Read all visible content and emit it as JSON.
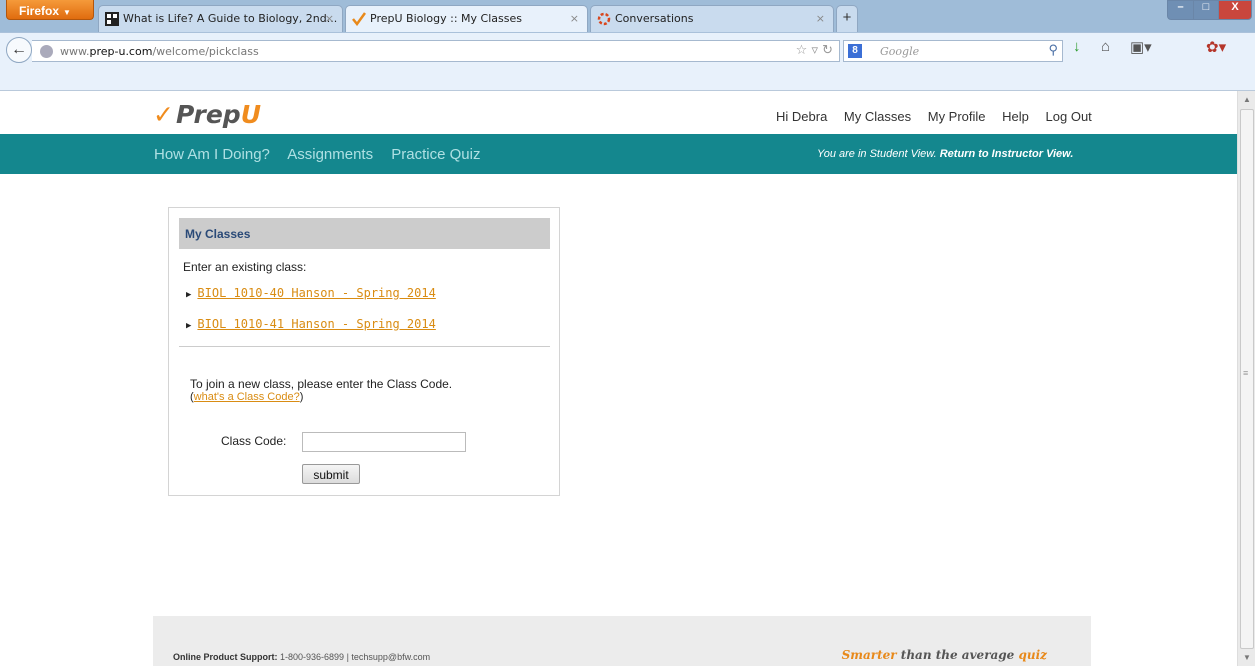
{
  "browser": {
    "menu_button": "Firefox",
    "tabs": [
      {
        "title": "What is Life? A Guide to Biology, 2nd...",
        "icon": "book-icon"
      },
      {
        "title": "PrepU Biology :: My Classes",
        "icon": "prepu-check-icon"
      },
      {
        "title": "Conversations",
        "icon": "ring-icon"
      }
    ],
    "url_prefix": "www.",
    "url_domain": "prep-u.com",
    "url_path": "/welcome/pickclass",
    "search_placeholder": "Google"
  },
  "site": {
    "logo_prefix": "Prep",
    "logo_accent": "U",
    "top_nav": [
      "Hi Debra",
      "My Classes",
      "My Profile",
      "Help",
      "Log Out"
    ],
    "main_nav": [
      "How Am I Doing?",
      "Assignments",
      "Practice Quiz"
    ],
    "view_message": "You are in Student View.",
    "view_link": "Return to Instructor View."
  },
  "panel": {
    "title": "My Classes",
    "enter_label": "Enter an existing class:",
    "classes": [
      "BIOL 1010-40 Hanson - Spring 2014",
      "BIOL 1010-41 Hanson - Spring 2014"
    ],
    "join_text": "To join a new class, please enter the Class Code.",
    "join_link": "what's a Class Code?",
    "code_label": "Class Code:",
    "code_value": "",
    "submit_label": "submit"
  },
  "footer": {
    "support_label": "Online Product Support:",
    "support_info": "1-800-936-6899  |  techsupp@bfw.com",
    "tagline_word1": "Smarter",
    "tagline_mid": "than the average",
    "tagline_word2": "quiz"
  },
  "colors": {
    "teal": "#14878e",
    "orange": "#f08c1e",
    "link": "#d98c13"
  }
}
